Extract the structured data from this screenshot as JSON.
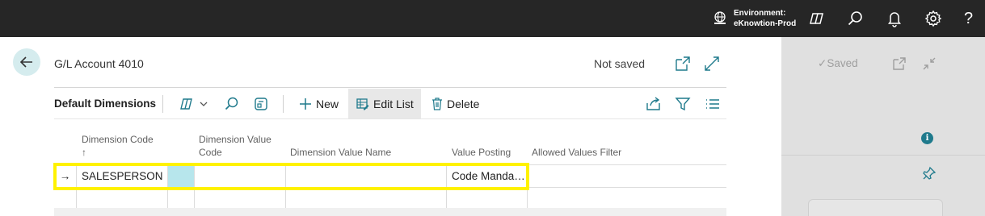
{
  "topbar": {
    "env_label": "Environment:",
    "env_value": "eKnowtion-Prod",
    "icons": [
      "globe-icon",
      "copilot-icon",
      "search-icon",
      "bell-icon",
      "gear-icon",
      "help-icon"
    ],
    "help_glyph": "?"
  },
  "background_page": {
    "saved_label": "Saved",
    "info_glyph": "i"
  },
  "dialog": {
    "title": "G/L Account 4010",
    "status": "Not saved"
  },
  "part": {
    "title": "Default Dimensions",
    "actions": {
      "new": "New",
      "edit_list": "Edit List",
      "delete": "Delete"
    }
  },
  "grid": {
    "columns": {
      "dimension_code": "Dimension Code",
      "sort_indicator": "↑",
      "dimension_value_code_1": "Dimension Value",
      "dimension_value_code_2": "Code",
      "dimension_value_name": "Dimension Value Name",
      "value_posting": "Value Posting",
      "allowed_values_filter": "Allowed Values Filter"
    },
    "rows": [
      {
        "indicator": "→",
        "dimension_code": "SALESPERSON",
        "dimension_value_code": "",
        "dimension_value_name": "",
        "value_posting": "Code Manda…",
        "allowed_values_filter": ""
      },
      {
        "indicator": "",
        "dimension_code": "",
        "dimension_value_code": "",
        "dimension_value_name": "",
        "value_posting": "",
        "allowed_values_filter": ""
      }
    ]
  },
  "colors": {
    "topbar": "#262626",
    "accent_teal": "#1f7a8c",
    "selected_cell": "#b7e6ec",
    "highlight": "#fff200"
  }
}
